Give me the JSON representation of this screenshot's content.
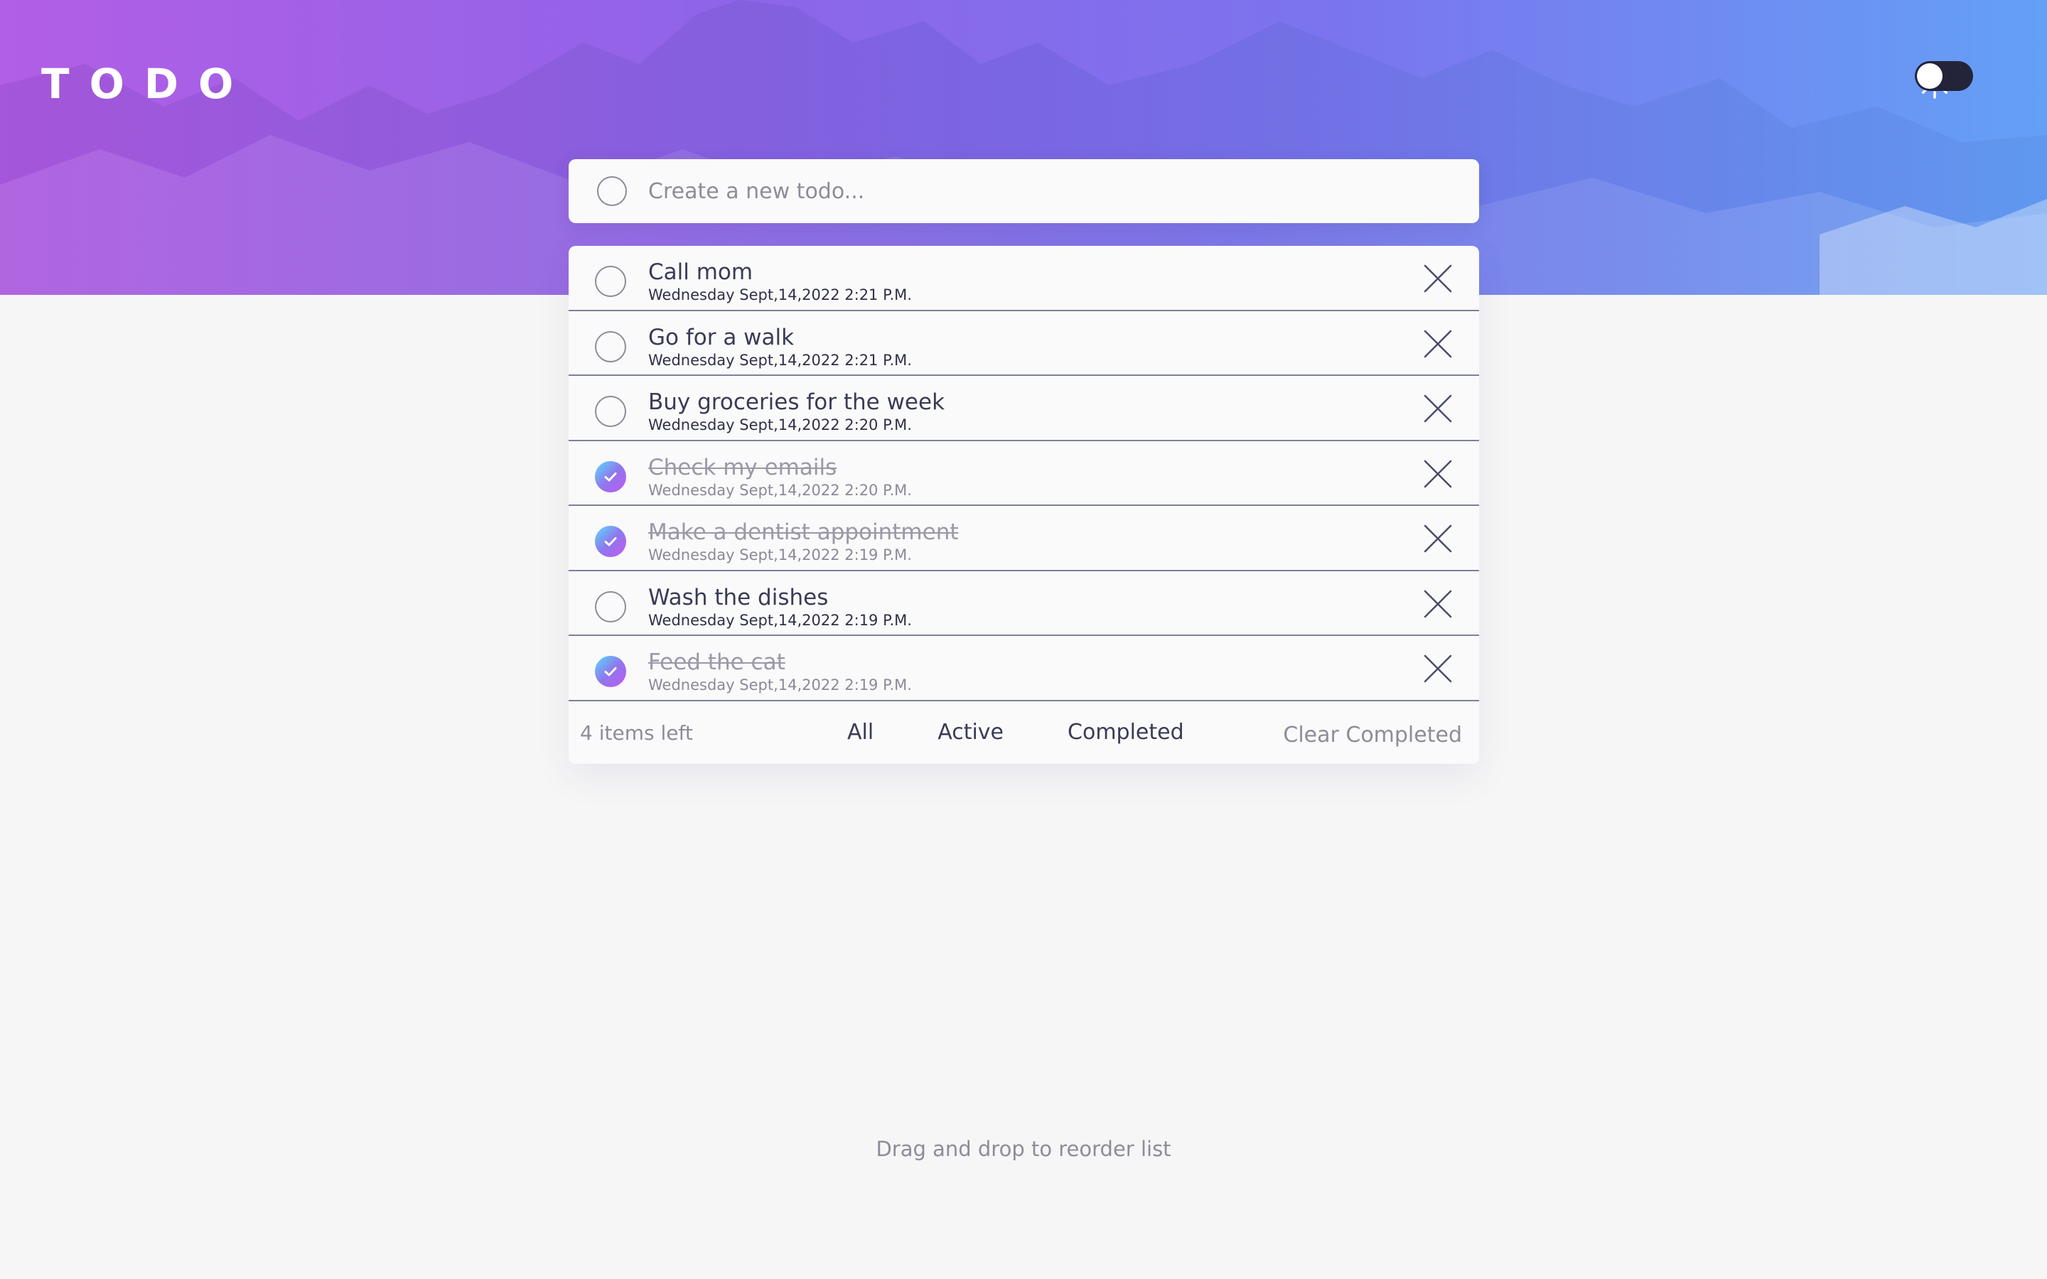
{
  "header": {
    "logo": "TODO",
    "theme_icon": "sun-icon"
  },
  "new_todo": {
    "placeholder": "Create a new todo..."
  },
  "todos": [
    {
      "title": "Call mom",
      "date": "Wednesday Sept,14,2022 2:21 P.M.",
      "completed": false
    },
    {
      "title": "Go for a walk",
      "date": "Wednesday Sept,14,2022 2:21 P.M.",
      "completed": false
    },
    {
      "title": "Buy groceries for the week",
      "date": "Wednesday Sept,14,2022 2:20 P.M.",
      "completed": false
    },
    {
      "title": "Check my emails",
      "date": "Wednesday Sept,14,2022 2:20 P.M.",
      "completed": true
    },
    {
      "title": "Make a dentist appointment",
      "date": "Wednesday Sept,14,2022 2:19 P.M.",
      "completed": true
    },
    {
      "title": "Wash the dishes",
      "date": "Wednesday Sept,14,2022 2:19 P.M.",
      "completed": false
    },
    {
      "title": "Feed the cat",
      "date": "Wednesday Sept,14,2022 2:19 P.M.",
      "completed": true
    }
  ],
  "footer": {
    "items_left": "4 items left",
    "filter_all": "All",
    "filter_active": "Active",
    "filter_completed": "Completed",
    "clear_completed": "Clear Completed"
  },
  "hint": "Drag and drop to reorder list",
  "colors": {
    "gradient_start": "#57ddff",
    "gradient_end": "#c058f3",
    "text_dark": "#3a3b56",
    "text_muted": "#8d8c99",
    "page_bg": "#f6f6f6"
  }
}
